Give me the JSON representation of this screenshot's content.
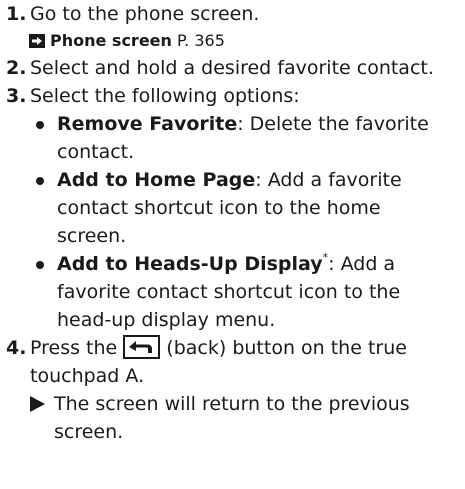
{
  "steps": [
    {
      "num": "1.",
      "text": "Go to the phone screen.",
      "ref": {
        "title": "Phone screen",
        "page": " P. 365"
      }
    },
    {
      "num": "2.",
      "text": "Select and hold a desired favorite contact."
    },
    {
      "num": "3.",
      "text": "Select the following options:",
      "options": [
        {
          "name": "Remove Favorite",
          "star": "",
          "desc_l1": ": Delete the favorite",
          "desc_l2": "contact.",
          "desc_l3": ""
        },
        {
          "name": "Add to Home Page",
          "star": "",
          "desc_l1": ": Add a favorite",
          "desc_l2": "contact shortcut icon to the home",
          "desc_l3": "screen."
        },
        {
          "name": "Add to Heads-Up Display",
          "star": "*",
          "desc_l1": ": Add a",
          "desc_l2": "favorite contact shortcut icon to the",
          "desc_l3": "head-up display menu."
        }
      ]
    },
    {
      "num": "4.",
      "text_before": "Press the ",
      "text_after": " (back) button on the true",
      "text_l2": "touchpad A.",
      "result_l1": "The screen will return to the previous",
      "result_l2": "screen."
    }
  ],
  "icons": {
    "ref_arrow": "arrow-right-box-icon",
    "back": "back-arrow-icon",
    "bullet": "bullet-dot-icon",
    "result": "triangle-right-icon"
  }
}
